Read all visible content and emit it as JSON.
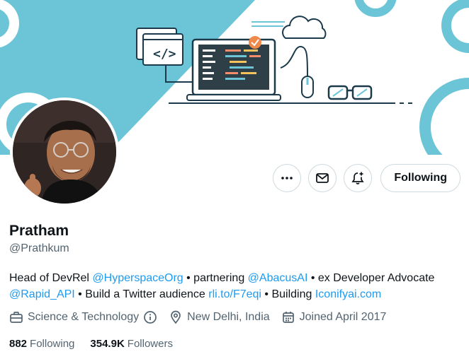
{
  "profile": {
    "name": "Pratham",
    "handle": "@Prathkum",
    "bio": {
      "t1": "Head of DevRel ",
      "link_hyperspace": "@HyperspaceOrg",
      "t2": " • partnering ",
      "link_abacus": "@AbacusAI",
      "t3": " • ex Developer Advocate ",
      "link_rapidapi": "@Rapid_API",
      "t4": " • Build a Twitter audience ",
      "link_rli": "rli.to/F7eqi",
      "t5": " • Building ",
      "link_iconify": "Iconifyai.com"
    },
    "category": "Science & Technology",
    "location": "New Delhi, India",
    "joined": "Joined April 2017",
    "following_count": "882",
    "following_label": "Following",
    "followers_count": "354.9K",
    "followers_label": "Followers"
  },
  "actions": {
    "follow_label": "Following",
    "icons": [
      "more-icon",
      "mail-icon",
      "notification-bell-icon"
    ]
  },
  "colors": {
    "link": "#1d9bf0",
    "banner_blue": "#6cc4d7",
    "secondary_text": "#536471",
    "border": "#cfd9de"
  }
}
